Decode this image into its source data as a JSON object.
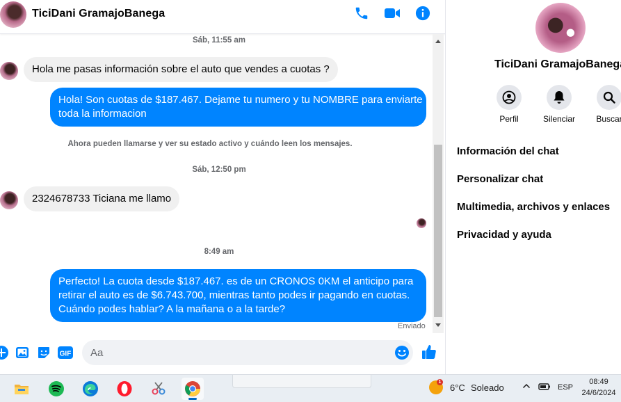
{
  "header": {
    "contact_name": "TiciDani GramajoBanega",
    "icons": [
      "phone-icon",
      "video-icon",
      "info-icon"
    ],
    "accent_color": "#0084ff"
  },
  "messages": {
    "timestamp_1": "Sáb, 11:55 am",
    "incoming_1": "Hola me pasas información sobre el auto que vendes a cuotas ?",
    "outgoing_1_line1": "Hola! Son cuotas de $187.467. Dejame tu numero y tu NOMBRE para enviarte",
    "outgoing_1_line2": "toda la informacion",
    "system_note": "Ahora pueden llamarse y ver su estado activo y cuándo leen los mensajes.",
    "timestamp_2": "Sáb, 12:50 pm",
    "incoming_2": "2324678733 Ticiana me llamo",
    "timestamp_3": "8:49 am",
    "outgoing_2_line1": "Perfecto! La cuota desde $187.467. es de un CRONOS 0KM el anticipo para",
    "outgoing_2_line2": "retirar el auto es de $6.743.700, mientras tanto podes ir pagando en cuotas.",
    "outgoing_2_line3": "Cuándo podes hablar? A la mañana o a la tarde?",
    "status": "Enviado"
  },
  "composer": {
    "placeholder": "Aa",
    "icons": [
      "plus-icon",
      "image-icon",
      "sticker-icon",
      "gif-icon",
      "emoji-icon",
      "like-icon"
    ],
    "gif_label": "GIF"
  },
  "panel": {
    "name": "TiciDani GramajoBanega",
    "actions": [
      {
        "label": "Perfil",
        "icon": "profile-icon"
      },
      {
        "label": "Silenciar",
        "icon": "bell-icon"
      },
      {
        "label": "Buscar",
        "icon": "search-icon"
      }
    ],
    "menu": [
      "Información del chat",
      "Personalizar chat",
      "Multimedia, archivos y enlaces",
      "Privacidad y ayuda"
    ]
  },
  "taskbar": {
    "apps": [
      "file-explorer-icon",
      "spotify-icon",
      "edge-icon",
      "opera-icon",
      "snipping-tool-icon",
      "chrome-icon"
    ],
    "weather_badge": "1",
    "temperature": "6°C",
    "weather": "Soleado",
    "language": "ESP",
    "time": "08:49",
    "date": "24/6/2024"
  }
}
